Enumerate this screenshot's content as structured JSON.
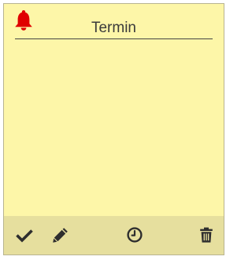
{
  "note": {
    "title": "Termin",
    "reminder_icon": "bell-icon",
    "colors": {
      "background": "#fdf6a8",
      "toolbar": "#e6df9e",
      "bell": "#e00000",
      "icons": "#2e2e2e",
      "border": "#b8b490"
    }
  },
  "toolbar": {
    "icons": [
      "check-icon",
      "pencil-icon",
      "clock-icon",
      "trash-icon"
    ]
  }
}
